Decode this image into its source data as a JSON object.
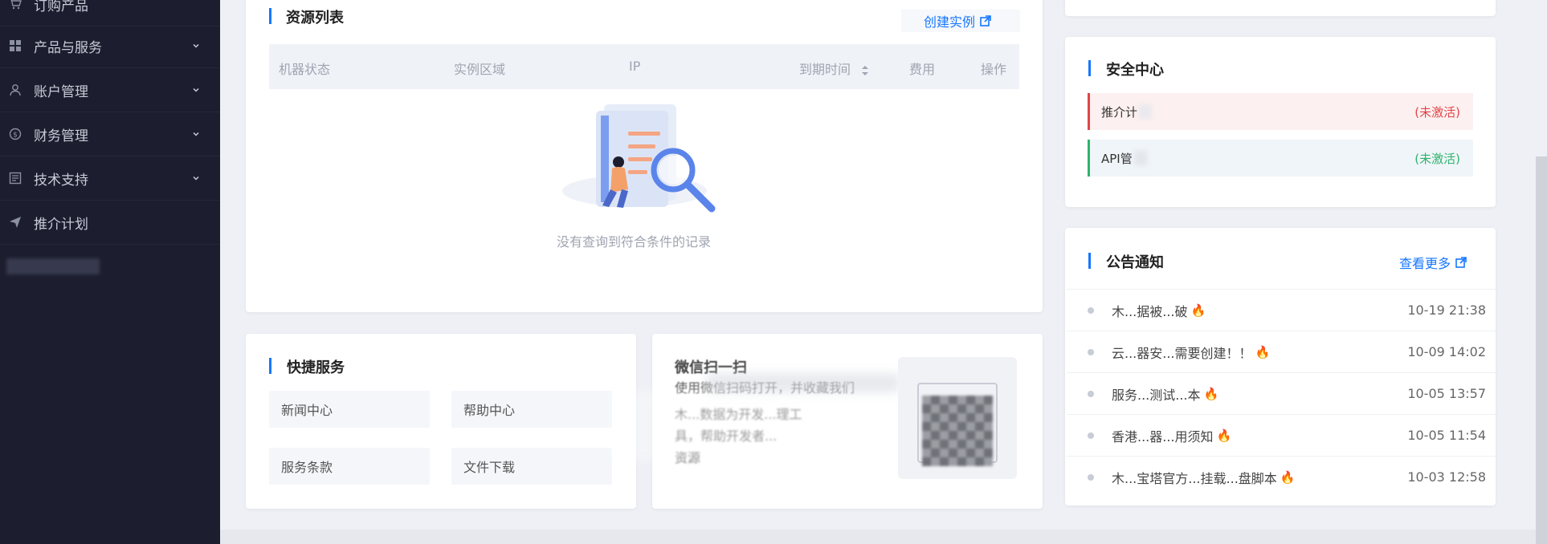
{
  "sidebar": {
    "items": [
      {
        "label": "订购产品",
        "icon": "cart-icon"
      },
      {
        "label": "产品与服务",
        "icon": "grid-icon"
      },
      {
        "label": "账户管理",
        "icon": "user-icon"
      },
      {
        "label": "财务管理",
        "icon": "dollar-icon"
      },
      {
        "label": "技术支持",
        "icon": "document-icon"
      },
      {
        "label": "推介计划",
        "icon": "send-icon"
      }
    ]
  },
  "resource": {
    "title": "资源列表",
    "create_link": "创建实例",
    "columns": [
      "机器状态",
      "实例区域",
      "IP",
      "到期时间",
      "费用",
      "操作"
    ],
    "empty_text": "没有查询到符合条件的记录"
  },
  "quick": {
    "title": "快捷服务",
    "buttons": [
      "新闻中心",
      "帮助中心",
      "服务条款",
      "文件下载"
    ]
  },
  "wechat": {
    "title": "微信扫一扫",
    "line1": "使用微信扫码打开，并收藏我们",
    "line2": "木...数据为开发...理工",
    "line3": "具，帮助开发者...",
    "line4": "资源"
  },
  "security": {
    "title": "安全中心",
    "rows": [
      {
        "label": "推介计",
        "status": "(未激活)",
        "color": "#e0464a"
      },
      {
        "label": "API管",
        "status": "(未激活)",
        "color": "#2fb36b"
      }
    ]
  },
  "notices": {
    "title": "公告通知",
    "more_link": "查看更多",
    "items": [
      {
        "text": "木...据被...破",
        "date": "10-19 21:38"
      },
      {
        "text": "云...器安...需要创建！！",
        "date": "10-09 14:02"
      },
      {
        "text": "服务...测试...本",
        "date": "10-05 13:57"
      },
      {
        "text": "香港...器...用须知",
        "date": "10-05 11:54"
      },
      {
        "text": "木...宝塔官方...挂载...盘脚本",
        "date": "10-03 12:58"
      }
    ]
  },
  "colors": {
    "accent": "#1677ff",
    "sidebar_bg": "#1c1e2f",
    "danger": "#e0464a",
    "success": "#2fb36b"
  }
}
